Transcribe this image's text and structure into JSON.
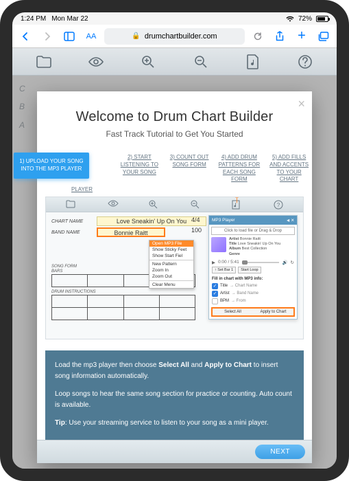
{
  "status": {
    "time": "1:24 PM",
    "date": "Mon Mar 22",
    "battery": "72%"
  },
  "browser": {
    "text_size": "AA",
    "domain": "drumchartbuilder.com"
  },
  "bg": {
    "c": "C",
    "b": "B",
    "a": "A"
  },
  "modal": {
    "title": "Welcome to Drum Chart Builder",
    "subtitle": "Fast Track Tutorial to Get You Started",
    "close": "×",
    "next": "NEXT"
  },
  "steps": [
    "1) UPLOAD YOUR SONG INTO THE MP3 PLAYER",
    "2) START LISTENING TO YOUR SONG",
    "3) COUNT OUT SONG FORM",
    "4) ADD DRUM PATTERNS FOR EACH SONG FORM",
    "5) ADD FILLS AND ACCENTS TO YOUR CHART"
  ],
  "steps_extra": "PLAYER",
  "screenshot": {
    "chart_name_label": "CHART NAME",
    "band_name_label": "BAND NAME",
    "chart_name": "Love Sneakin' Up On You",
    "band_name": "Bonnie Raitt",
    "time_sig": "4/4",
    "tempo": "100",
    "menu": {
      "open": "Open MP3 File",
      "show_sticky": "Show Sticky Feet",
      "show_start": "Show Start Fiel",
      "new_pattern": "New Pattern",
      "zoom_in": "Zoom In",
      "zoom_out": "Zoom Out",
      "clear": "Clear Menu"
    },
    "grid": {
      "song_form": "SONG FORM",
      "bars": "BARS",
      "drum_instructions": "DRUM INSTRUCTIONS"
    },
    "mp3": {
      "title": "MP3 Player",
      "drop": "Click to load file or Drag & Drop",
      "artist_lbl": "Artist",
      "title_lbl": "Title",
      "album_lbl": "Album",
      "genre_lbl": "Genre",
      "artist": "Bonnie Raitt",
      "song": "Love Sneakin' Up On You",
      "album": "Best Collection",
      "time": "0:00 / 5:41",
      "loop": "↻",
      "set_bar": "↑ Set Bar 1",
      "start_loop": "Start Loop",
      "fill_title": "Fill in chart with MP3 info:",
      "chk_title": "Title",
      "chk_title_to": "→ Chart Name",
      "chk_artist": "Artist",
      "chk_artist_to": "→ Band Name",
      "chk_bpm": "BPM",
      "chk_bpm_to": "→ From",
      "select_all": "Select All",
      "apply": "Apply to Chart"
    }
  },
  "info": {
    "p1a": "Load the mp3 player then choose ",
    "p1b": "Select All",
    "p1c": " and ",
    "p1d": "Apply to Chart",
    "p1e": " to insert song information automatically.",
    "p2": "Loop songs to hear the same song section for practice or counting. Auto count is available.",
    "p3a": "Tip",
    "p3b": ": Use your streaming service to listen to your song as a mini player."
  }
}
